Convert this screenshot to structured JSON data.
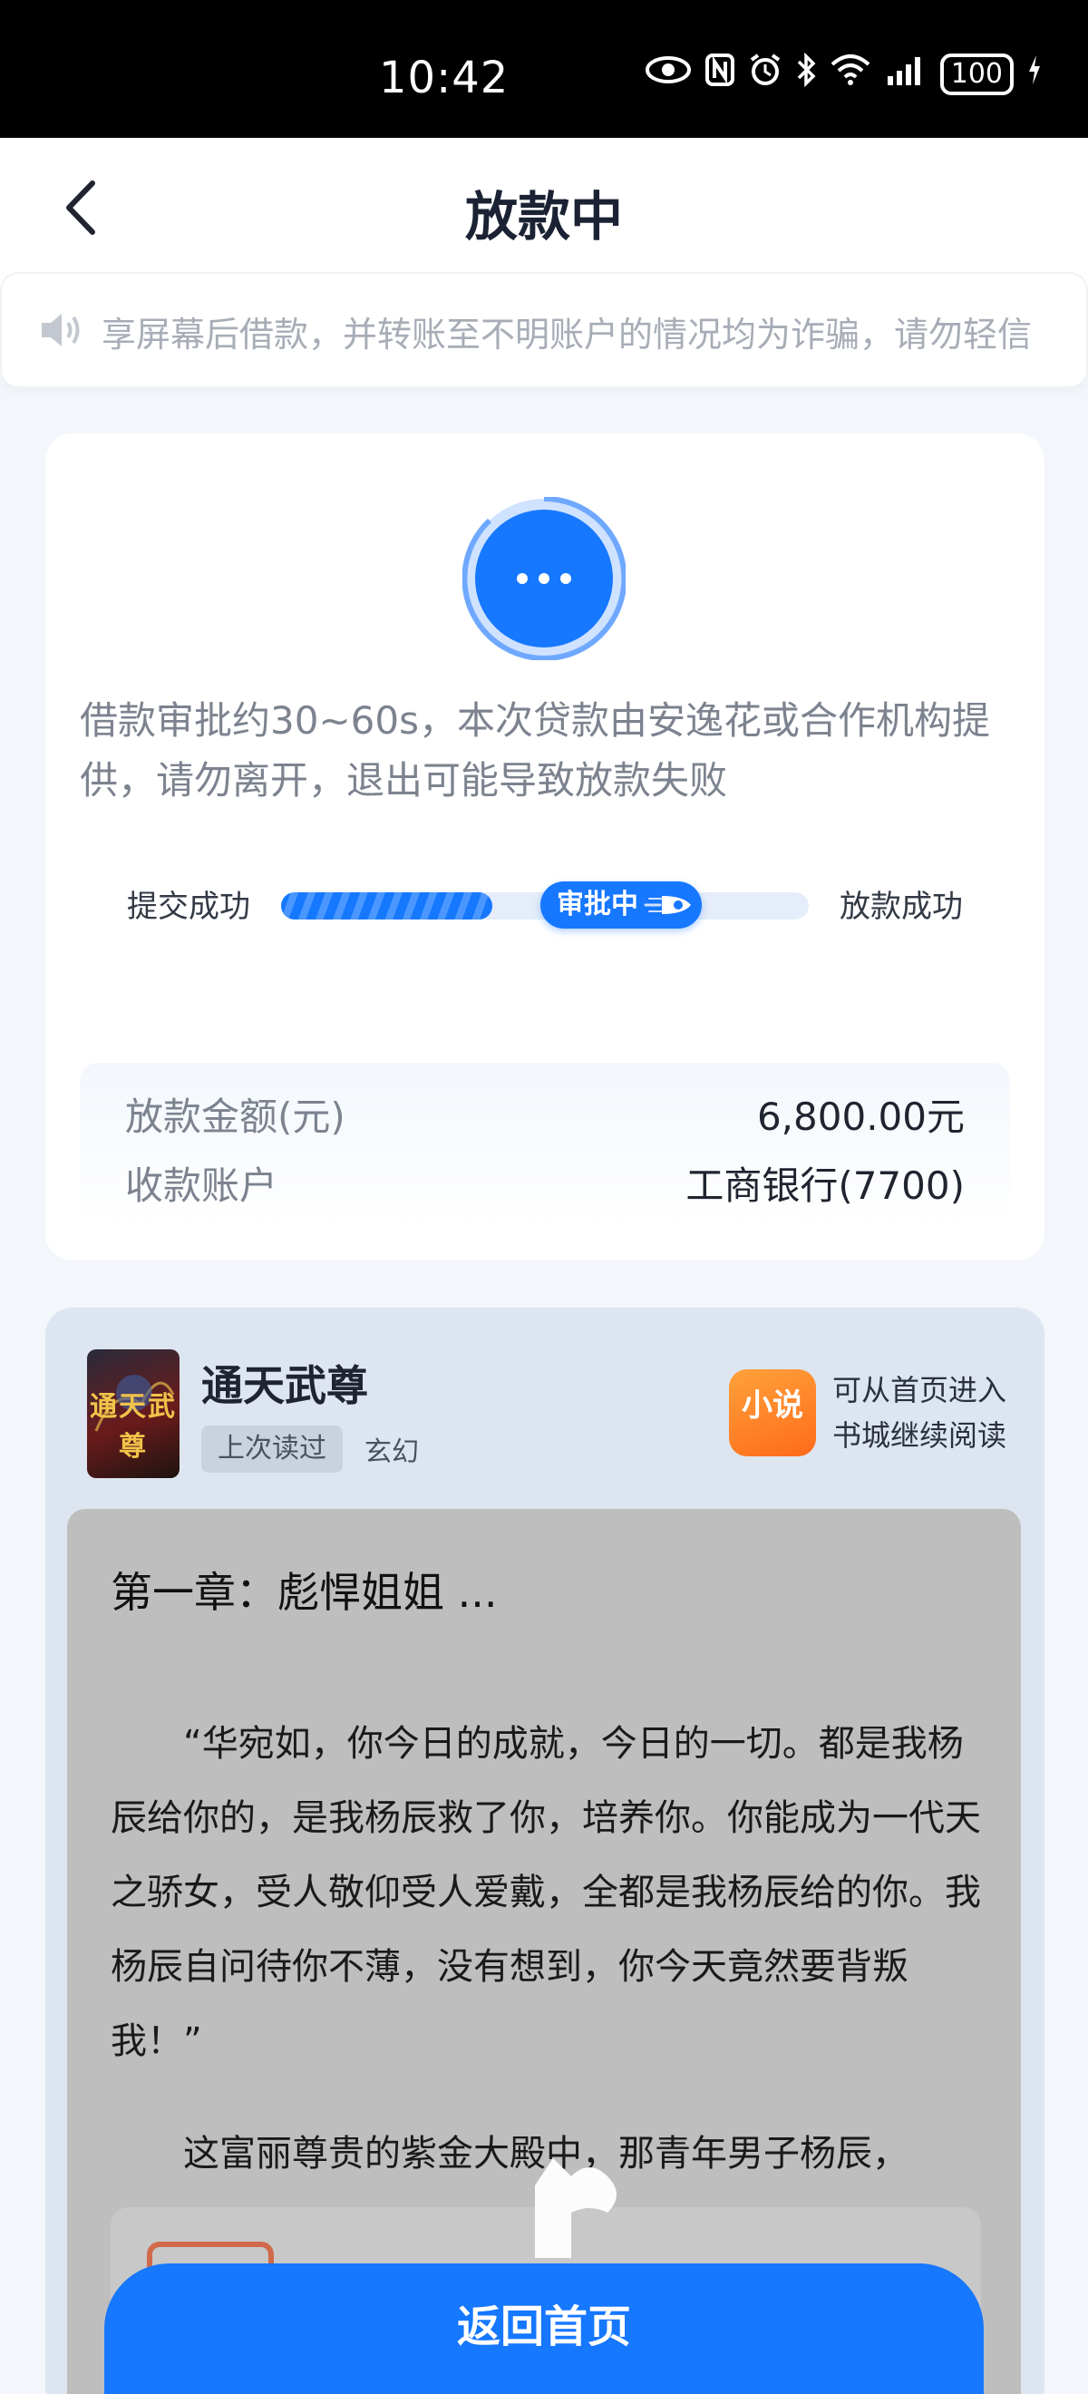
{
  "status_bar": {
    "time": "10:42",
    "battery": "100"
  },
  "header": {
    "title": "放款中",
    "back_icon": "chevron-left-icon"
  },
  "notice": {
    "icon": "speaker-icon",
    "text": "享屏幕后借款，并转账至不明账户的情况均为诈骗，请勿轻信"
  },
  "status_card": {
    "hint": "借款审批约30~60s，本次贷款由安逸花或合作机构提供，请勿离开，退出可能导致放款失败",
    "steps": {
      "left": "提交成功",
      "current": "审批中",
      "right": "放款成功"
    },
    "progress_fraction": 0.4,
    "amount_label": "放款金额(元)",
    "amount_value": "6,800.00元",
    "account_label": "收款账户",
    "account_value": "工商银行(7700)"
  },
  "reading_card": {
    "book_title": "通天武尊",
    "cover_text": "通天武尊",
    "last_read_tag": "上次读过",
    "genre": "玄幻",
    "app_icon_label": "小说",
    "app_hint_line1": "可从首页进入",
    "app_hint_line2": "书城继续阅读",
    "chapter_title": "第一章：彪悍姐姐 ...",
    "paragraph1": "“华宛如，你今日的成就，今日的一切。都是我杨辰给你的，是我杨辰救了你，培养你。你能成为一代天之骄女，受人敬仰受人爱戴，全都是我杨辰给的你。我杨辰自问待你不薄，没有想到，你今天竟然要背叛我！”",
    "paragraph2": "这富丽尊贵的紫金大殿中，那青年男子杨辰，"
  },
  "footer": {
    "home_button": "返回首页"
  },
  "colors": {
    "accent": "#1677ff",
    "page_bg": "#f3f6fa",
    "reader_bg": "#bebebe"
  }
}
